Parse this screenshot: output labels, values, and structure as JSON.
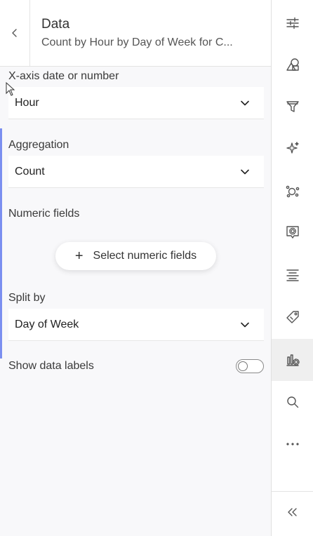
{
  "header": {
    "title": "Data",
    "subtitle": "Count by Hour by Day of Week for C..."
  },
  "fields": {
    "xaxis_label": "X-axis date or number",
    "xaxis_value": "Hour",
    "aggregation_label": "Aggregation",
    "aggregation_value": "Count",
    "numeric_label": "Numeric fields",
    "numeric_button": "Select numeric fields",
    "split_label": "Split by",
    "split_value": "Day of Week",
    "data_labels_label": "Show data labels",
    "data_labels_on": false
  },
  "rail": {
    "icons": [
      "sliders-icon",
      "shapes-icon",
      "filter-icon",
      "sparkle-icon",
      "cluster-icon",
      "settings-popup-icon",
      "align-icon",
      "tag-edit-icon",
      "chart-settings-icon",
      "search-icon",
      "more-icon",
      "collapse-icon"
    ],
    "active": "chart-settings-icon"
  },
  "colors": {
    "accent": "#7b8ff0",
    "panel_bg": "#f8f8fa"
  }
}
